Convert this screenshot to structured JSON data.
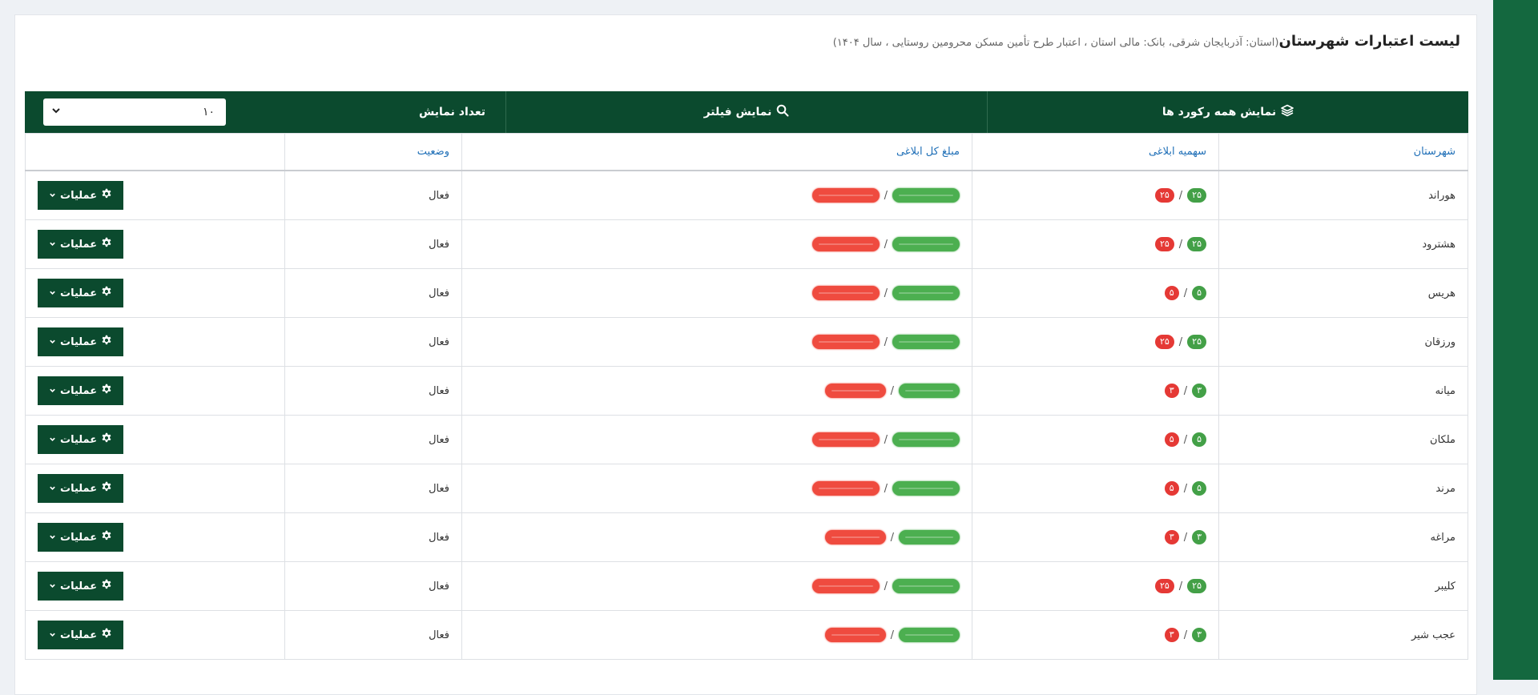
{
  "header": {
    "title": "لیست اعتبارات شهرستان",
    "subtitle": "(استان: آذربایجان شرقی، بانک: مالی استان ، اعتبار طرح تأمین مسکن محرومین روستایی ، سال ۱۴۰۴)"
  },
  "toolbar": {
    "show_all_label": "نمایش همه رکورد ها",
    "show_filter_label": "نمایش فیلتر",
    "page_size_label": "تعداد نمایش",
    "page_size_value": "۱۰"
  },
  "table": {
    "columns": [
      "شهرستان",
      "سهمیه ابلاغی",
      "مبلغ کل ابلاغی",
      "وضعیت",
      ""
    ],
    "operations_label": "عملیات",
    "separator": "/",
    "rows": [
      {
        "county": "هوراند",
        "quota_green": "۲۵",
        "quota_red": "۲۵",
        "status": "فعال"
      },
      {
        "county": "هشترود",
        "quota_green": "۲۵",
        "quota_red": "۲۵",
        "status": "فعال"
      },
      {
        "county": "هریس",
        "quota_green": "۵",
        "quota_red": "۵",
        "status": "فعال"
      },
      {
        "county": "ورزقان",
        "quota_green": "۲۵",
        "quota_red": "۲۵",
        "status": "فعال"
      },
      {
        "county": "میانه",
        "quota_green": "۳",
        "quota_red": "۳",
        "status": "فعال"
      },
      {
        "county": "ملکان",
        "quota_green": "۵",
        "quota_red": "۵",
        "status": "فعال"
      },
      {
        "county": "مرند",
        "quota_green": "۵",
        "quota_red": "۵",
        "status": "فعال"
      },
      {
        "county": "مراغه",
        "quota_green": "۳",
        "quota_red": "۳",
        "status": "فعال"
      },
      {
        "county": "کلیبر",
        "quota_green": "۲۵",
        "quota_red": "۲۵",
        "status": "فعال"
      },
      {
        "county": "عجب شیر",
        "quota_green": "۳",
        "quota_red": "۳",
        "status": "فعال"
      }
    ]
  },
  "colors": {
    "primary": "#0b4a2e",
    "accent_strip": "#14683f",
    "badge_green": "#43a047",
    "badge_red": "#e53935",
    "header_link": "#1f6fb7"
  },
  "icons": {
    "show_all": "layers-icon",
    "show_filter": "search-icon",
    "page_size": "chevron-down-icon",
    "operations": "gear-icon"
  }
}
